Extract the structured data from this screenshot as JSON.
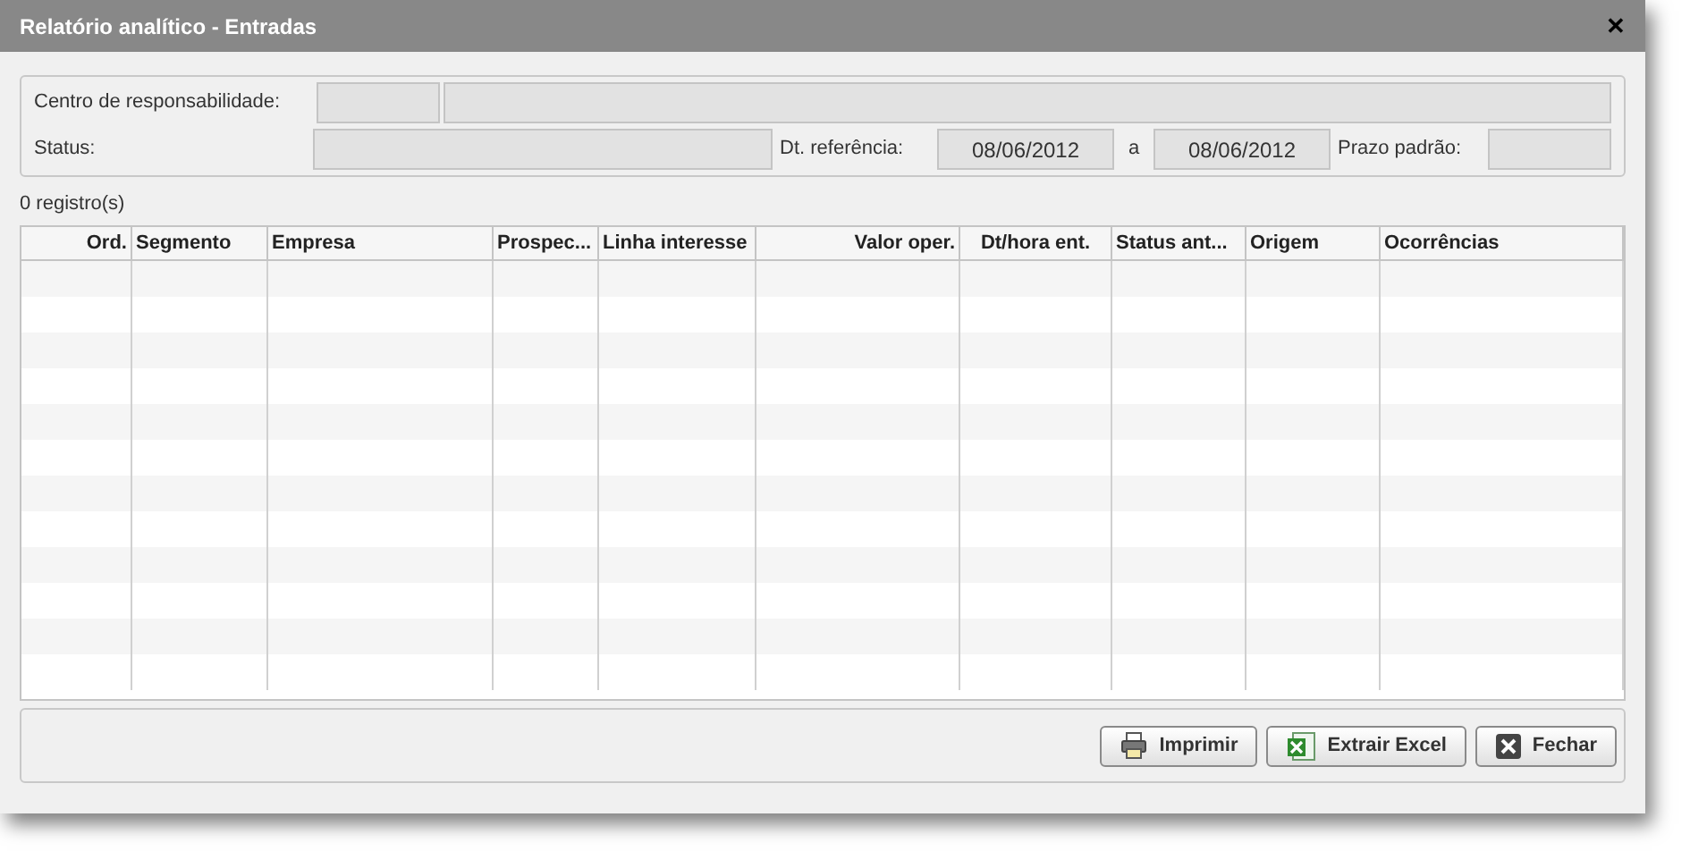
{
  "window": {
    "title": "Relatório analítico - Entradas",
    "close": "✕"
  },
  "filters": {
    "centro_label": "Centro de responsabilidade:",
    "status_label": "Status:",
    "dt_label": "Dt. referência:",
    "date_from": "08/06/2012",
    "date_sep": "a",
    "date_to": "08/06/2012",
    "prazo_label": "Prazo padrão:"
  },
  "count": "0 registro(s)",
  "table": {
    "columns": [
      {
        "label": "Ord."
      },
      {
        "label": "Segmento"
      },
      {
        "label": "Empresa"
      },
      {
        "label": "Prospec..."
      },
      {
        "label": "Linha interesse"
      },
      {
        "label": "Valor oper."
      },
      {
        "label": "Dt/hora ent."
      },
      {
        "label": "Status ant..."
      },
      {
        "label": "Origem"
      },
      {
        "label": "Ocorrências"
      }
    ]
  },
  "buttons": [
    {
      "label": "Imprimir",
      "kind": "print"
    },
    {
      "label": "Extrair Excel",
      "kind": "excel"
    },
    {
      "label": "Fechar",
      "kind": "close"
    }
  ]
}
